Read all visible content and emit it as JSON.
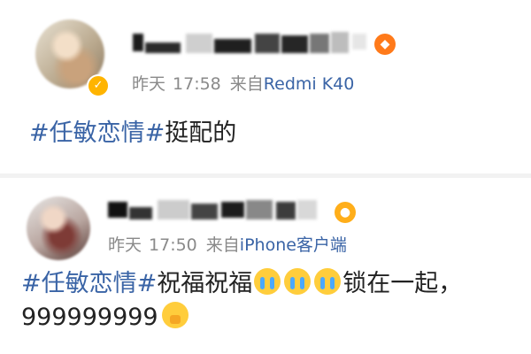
{
  "posts": [
    {
      "time_label": "昨天",
      "time": "17:58",
      "source_prefix": "来自",
      "device": "Redmi K40",
      "hashtag": "#任敏恋情#",
      "text": "挺配的"
    },
    {
      "time_label": "昨天",
      "time": "17:50",
      "source_prefix": "来自",
      "device": "iPhone客户端",
      "hashtag": "#任敏恋情#",
      "text_before_emoji": "祝福祝福",
      "text_after_emoji": "锁在一起，",
      "text_line2": "999999999"
    }
  ],
  "icons": {
    "verified": "verified-badge-icon",
    "cry": "crying-face-icon",
    "hush": "shush-face-icon",
    "badge1": "fox-badge-icon",
    "badge2": "fish-badge-icon"
  },
  "colors": {
    "link": "#3a64a6",
    "meta": "#8a8a8a",
    "text": "#222222"
  }
}
